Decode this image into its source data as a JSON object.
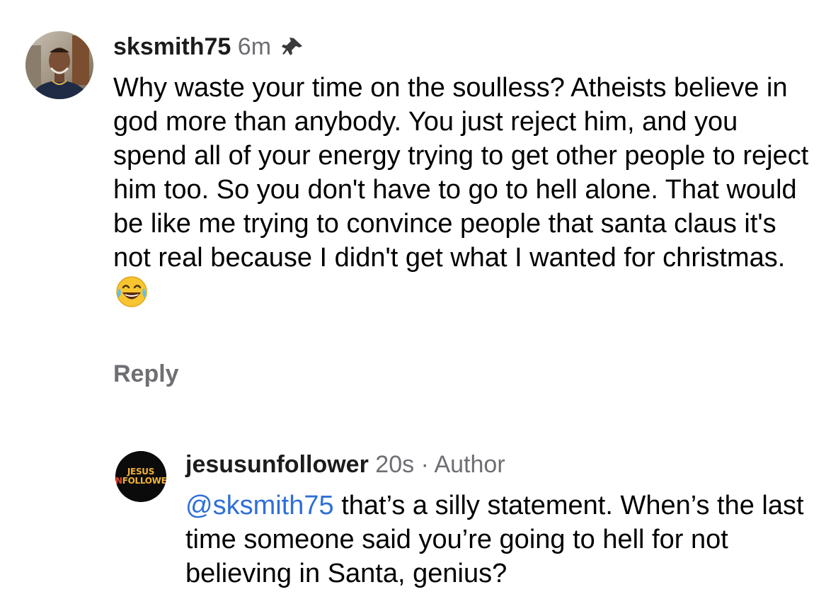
{
  "comment": {
    "username": "sksmith75",
    "time": "6m",
    "body": "Why waste your time on the soulless?  Atheists believe in god more than anybody.  You just reject him, and you spend all of your energy trying to get other people to reject him too.  So you don't have to go to hell alone.  That would be like me trying to convince people that santa claus it's not real because I didn't get what I wanted for christmas.",
    "emoji_icon": "face-with-tears-of-joy-icon",
    "pinned_icon": "pin-icon",
    "reply_label": "Reply"
  },
  "reply": {
    "username": "jesusunfollower",
    "time": "20s",
    "separator": "·",
    "badge": "Author",
    "mention": "@sksmith75",
    "body": " that’s a silly statement. When’s the last time someone said you’re going to hell for not believing in Santa, genius?",
    "avatar_logo_line1": "JESUS",
    "avatar_logo_line2_red": "UN",
    "avatar_logo_line2_rest": "FOLLOWER"
  },
  "colors": {
    "meta_gray": "#6e6e73",
    "mention_blue": "#2f6fd8",
    "logo_gold": "#f2b234",
    "logo_red": "#e8452c"
  }
}
